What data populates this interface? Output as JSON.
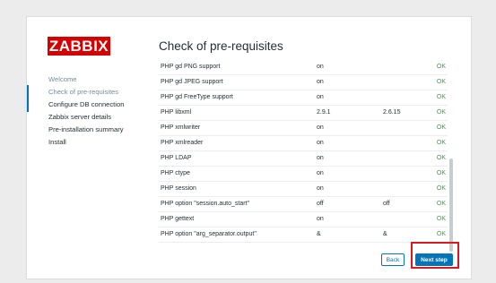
{
  "logo": {
    "text": "ZABBIX"
  },
  "steps": [
    {
      "label": "Welcome",
      "state": "done"
    },
    {
      "label": "Check of pre-requisites",
      "state": "active"
    },
    {
      "label": "Configure DB connection",
      "state": "pending"
    },
    {
      "label": "Zabbix server details",
      "state": "pending"
    },
    {
      "label": "Pre-installation summary",
      "state": "pending"
    },
    {
      "label": "Install",
      "state": "pending"
    }
  ],
  "main": {
    "title": "Check of pre-requisites",
    "rows": [
      {
        "name": "PHP gd PNG support",
        "current": "on",
        "required": "",
        "status": "OK"
      },
      {
        "name": "PHP gd JPEG support",
        "current": "on",
        "required": "",
        "status": "OK"
      },
      {
        "name": "PHP gd FreeType support",
        "current": "on",
        "required": "",
        "status": "OK"
      },
      {
        "name": "PHP libxml",
        "current": "2.9.1",
        "required": "2.6.15",
        "status": "OK"
      },
      {
        "name": "PHP xmlwriter",
        "current": "on",
        "required": "",
        "status": "OK"
      },
      {
        "name": "PHP xmlreader",
        "current": "on",
        "required": "",
        "status": "OK"
      },
      {
        "name": "PHP LDAP",
        "current": "on",
        "required": "",
        "status": "OK"
      },
      {
        "name": "PHP ctype",
        "current": "on",
        "required": "",
        "status": "OK"
      },
      {
        "name": "PHP session",
        "current": "on",
        "required": "",
        "status": "OK"
      },
      {
        "name": "PHP option \"session.auto_start\"",
        "current": "off",
        "required": "off",
        "status": "OK"
      },
      {
        "name": "PHP gettext",
        "current": "on",
        "required": "",
        "status": "OK"
      },
      {
        "name": "PHP option \"arg_separator.output\"",
        "current": "&",
        "required": "&",
        "status": "OK"
      }
    ]
  },
  "buttons": {
    "back": "Back",
    "next": "Next step"
  },
  "colors": {
    "brand": "#d40000",
    "accent": "#0275b8",
    "ok": "#3c9b45",
    "highlight": "#d9191f"
  }
}
